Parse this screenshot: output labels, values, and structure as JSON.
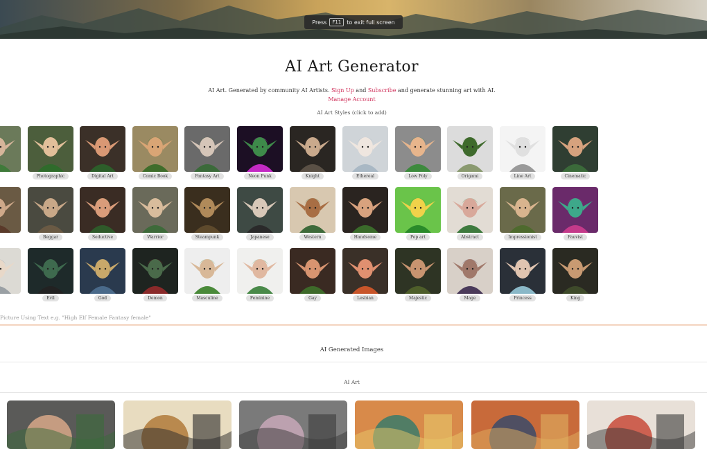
{
  "notice": {
    "before": "Press",
    "key": "F11",
    "after": "to exit full screen"
  },
  "title": "AI Art Generator",
  "subtitle": {
    "text1": "AI Art. Generated by community AI Artists.",
    "signup": "Sign Up",
    "and": "and",
    "subscribe": "Subscribe",
    "text2": "and generate stunning art with AI.",
    "manage": "Manage Account"
  },
  "styles_heading": "AI Art Styles (click to add)",
  "styles": [
    [
      {
        "label": "",
        "colors": [
          "#6b7a5a",
          "#d6b59a",
          "#3f7a3a"
        ]
      },
      {
        "label": "Photographic",
        "colors": [
          "#4c5e3c",
          "#e2bf9a",
          "#2f6b2b"
        ]
      },
      {
        "label": "Digital Art",
        "colors": [
          "#3b3028",
          "#d99874",
          "#2d5e2a"
        ]
      },
      {
        "label": "Comic Book",
        "colors": [
          "#9a8a62",
          "#d9a575",
          "#3f6d2b"
        ]
      },
      {
        "label": "Fantasy Art",
        "colors": [
          "#6a6a6a",
          "#d5c5b8",
          "#3b6a3a"
        ]
      },
      {
        "label": "Neon Punk",
        "colors": [
          "#1c0f24",
          "#3e8a4a",
          "#c32ac4"
        ]
      },
      {
        "label": "Knight",
        "colors": [
          "#2a2622",
          "#c9a98c",
          "#5a5045"
        ]
      },
      {
        "label": "Ethereal",
        "colors": [
          "#cfd4d8",
          "#efe6df",
          "#a9b8c4"
        ]
      },
      {
        "label": "Low Poly",
        "colors": [
          "#8c8c8c",
          "#e7b58c",
          "#3d8a3d"
        ]
      },
      {
        "label": "Origami",
        "colors": [
          "#dcdcdc",
          "#3e6a2c",
          "#8a9a70"
        ]
      },
      {
        "label": "Line Art",
        "colors": [
          "#f4f4f4",
          "#e0e0e0",
          "#9a9a9a"
        ]
      },
      {
        "label": "Cinematic",
        "colors": [
          "#2f3e32",
          "#d6a27e",
          "#3b6a3a"
        ]
      }
    ],
    [
      {
        "label": "",
        "colors": [
          "#6a5a44",
          "#cfa98a",
          "#5a3a2a"
        ]
      },
      {
        "label": "Beggar",
        "colors": [
          "#4a4a40",
          "#c8a888",
          "#6a5a44"
        ]
      },
      {
        "label": "Seductive",
        "colors": [
          "#3a2c24",
          "#d99c7a",
          "#2f5a2a"
        ]
      },
      {
        "label": "Warrior",
        "colors": [
          "#6a6a5a",
          "#d8bc9c",
          "#3e6a3a"
        ]
      },
      {
        "label": "Steampunk",
        "colors": [
          "#3a2e1e",
          "#b08a5a",
          "#5e4a2c"
        ]
      },
      {
        "label": "Japanese",
        "colors": [
          "#3e4a44",
          "#d8c8b8",
          "#2a2a2a"
        ]
      },
      {
        "label": "Western",
        "colors": [
          "#d8c8b0",
          "#a86e44",
          "#3e6a3a"
        ]
      },
      {
        "label": "Handsome",
        "colors": [
          "#2a2420",
          "#d8a27e",
          "#3a6a2a"
        ]
      },
      {
        "label": "Pop art",
        "colors": [
          "#6ac44a",
          "#f0d24a",
          "#2a8a2a"
        ]
      },
      {
        "label": "Abstract",
        "colors": [
          "#e2dcd4",
          "#d8a89a",
          "#3e7a3e"
        ]
      },
      {
        "label": "Impressionist",
        "colors": [
          "#6a6a4a",
          "#d8b48e",
          "#4e6a2e"
        ]
      },
      {
        "label": "Fauvist",
        "colors": [
          "#6a2a6a",
          "#3ea88a",
          "#c43a8a"
        ]
      }
    ],
    [
      {
        "label": "",
        "colors": [
          "#dcdad4",
          "#e8d8c8",
          "#9aa0a4"
        ]
      },
      {
        "label": "Evil",
        "colors": [
          "#1e2a2a",
          "#3e6a4e",
          "#222222"
        ]
      },
      {
        "label": "God",
        "colors": [
          "#2a3a4e",
          "#c8a86a",
          "#4a6a8a"
        ]
      },
      {
        "label": "Demon",
        "colors": [
          "#1e2420",
          "#4a6a4a",
          "#8a2a2a"
        ]
      },
      {
        "label": "Masculine",
        "colors": [
          "#eeeeee",
          "#d8b898",
          "#4a8a3a"
        ]
      },
      {
        "label": "Feminine",
        "colors": [
          "#f0f0ee",
          "#e0b8a0",
          "#4a8a4a"
        ]
      },
      {
        "label": "Gay",
        "colors": [
          "#3a2a22",
          "#d89470",
          "#3e6a2a"
        ]
      },
      {
        "label": "Lesbian",
        "colors": [
          "#3a3028",
          "#e09070",
          "#c8552a"
        ]
      },
      {
        "label": "Majestic",
        "colors": [
          "#2e3424",
          "#c89470",
          "#4e5e2a"
        ]
      },
      {
        "label": "Mage",
        "colors": [
          "#d8d0c8",
          "#a0786a",
          "#4a3a5a"
        ]
      },
      {
        "label": "Princess",
        "colors": [
          "#2a3038",
          "#e0c4b0",
          "#8ab8c8"
        ]
      },
      {
        "label": "King",
        "colors": [
          "#2a2a22",
          "#c89a72",
          "#3e4a2a"
        ]
      }
    ]
  ],
  "prompt_hint": "Picture Using Text e.g. \"High Elf Female Fantasy female\"",
  "generated_heading": "AI Generated Images",
  "all_art_label": "AI Art",
  "gallery": [
    {
      "colors": [
        "#5a5a58",
        "#d8a888",
        "#3a6a3a"
      ]
    },
    {
      "colors": [
        "#e8dcc0",
        "#b07a3a",
        "#2a2a2a"
      ]
    },
    {
      "colors": [
        "#7a7a7a",
        "#c8a8b8",
        "#3a3a3a"
      ]
    },
    {
      "colors": [
        "#d88a4a",
        "#3a7a6a",
        "#e8c86a"
      ]
    },
    {
      "colors": [
        "#c86a3a",
        "#3a4a6a",
        "#e0b060"
      ]
    },
    {
      "colors": [
        "#e8e0d8",
        "#c84a3a",
        "#3a3a3a"
      ]
    }
  ]
}
